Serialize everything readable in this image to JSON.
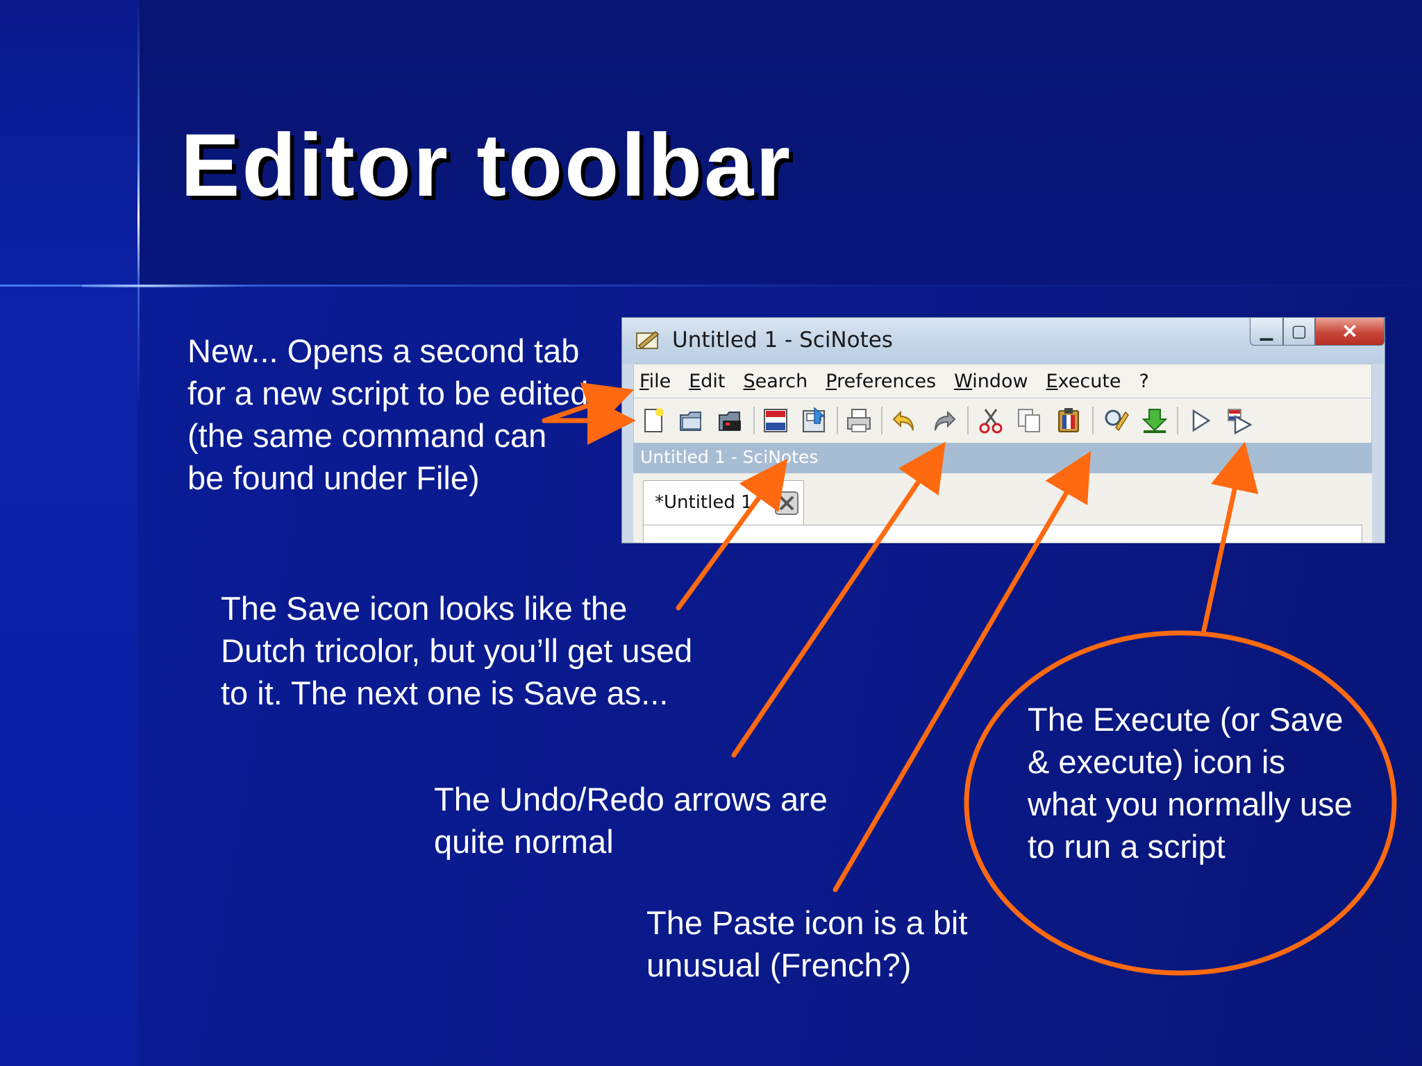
{
  "slide": {
    "title": "Editor toolbar",
    "notes": {
      "new": "New... Opens a second tab for a new script to be edited (the same command can be found under File)",
      "save": "The Save icon looks like the Dutch tricolor, but you’ll get used to it. The next one is Save as...",
      "undo": "The Undo/Redo arrows are quite normal",
      "paste": "The Paste icon is a bit unusual (French?)",
      "execute": "The Execute (or Save & execute) icon is what you normally use to run a script"
    },
    "accent_color": "#ff6a10"
  },
  "window": {
    "title": "Untitled 1 - SciNotes",
    "menu": [
      "File",
      "Edit",
      "Search",
      "Preferences",
      "Window",
      "Execute",
      "?"
    ],
    "toolbar_icons": [
      "new-file-icon",
      "open-folder-icon",
      "open-file-icon",
      "save-icon",
      "save-as-icon",
      "print-icon",
      "undo-icon",
      "redo-icon",
      "cut-icon",
      "copy-icon",
      "paste-icon",
      "find-icon",
      "load-into-scilab-icon",
      "execute-icon",
      "save-and-execute-icon"
    ],
    "panel_title": "Untitled 1 - SciNotes",
    "tab_label": "*Untitled 1"
  }
}
